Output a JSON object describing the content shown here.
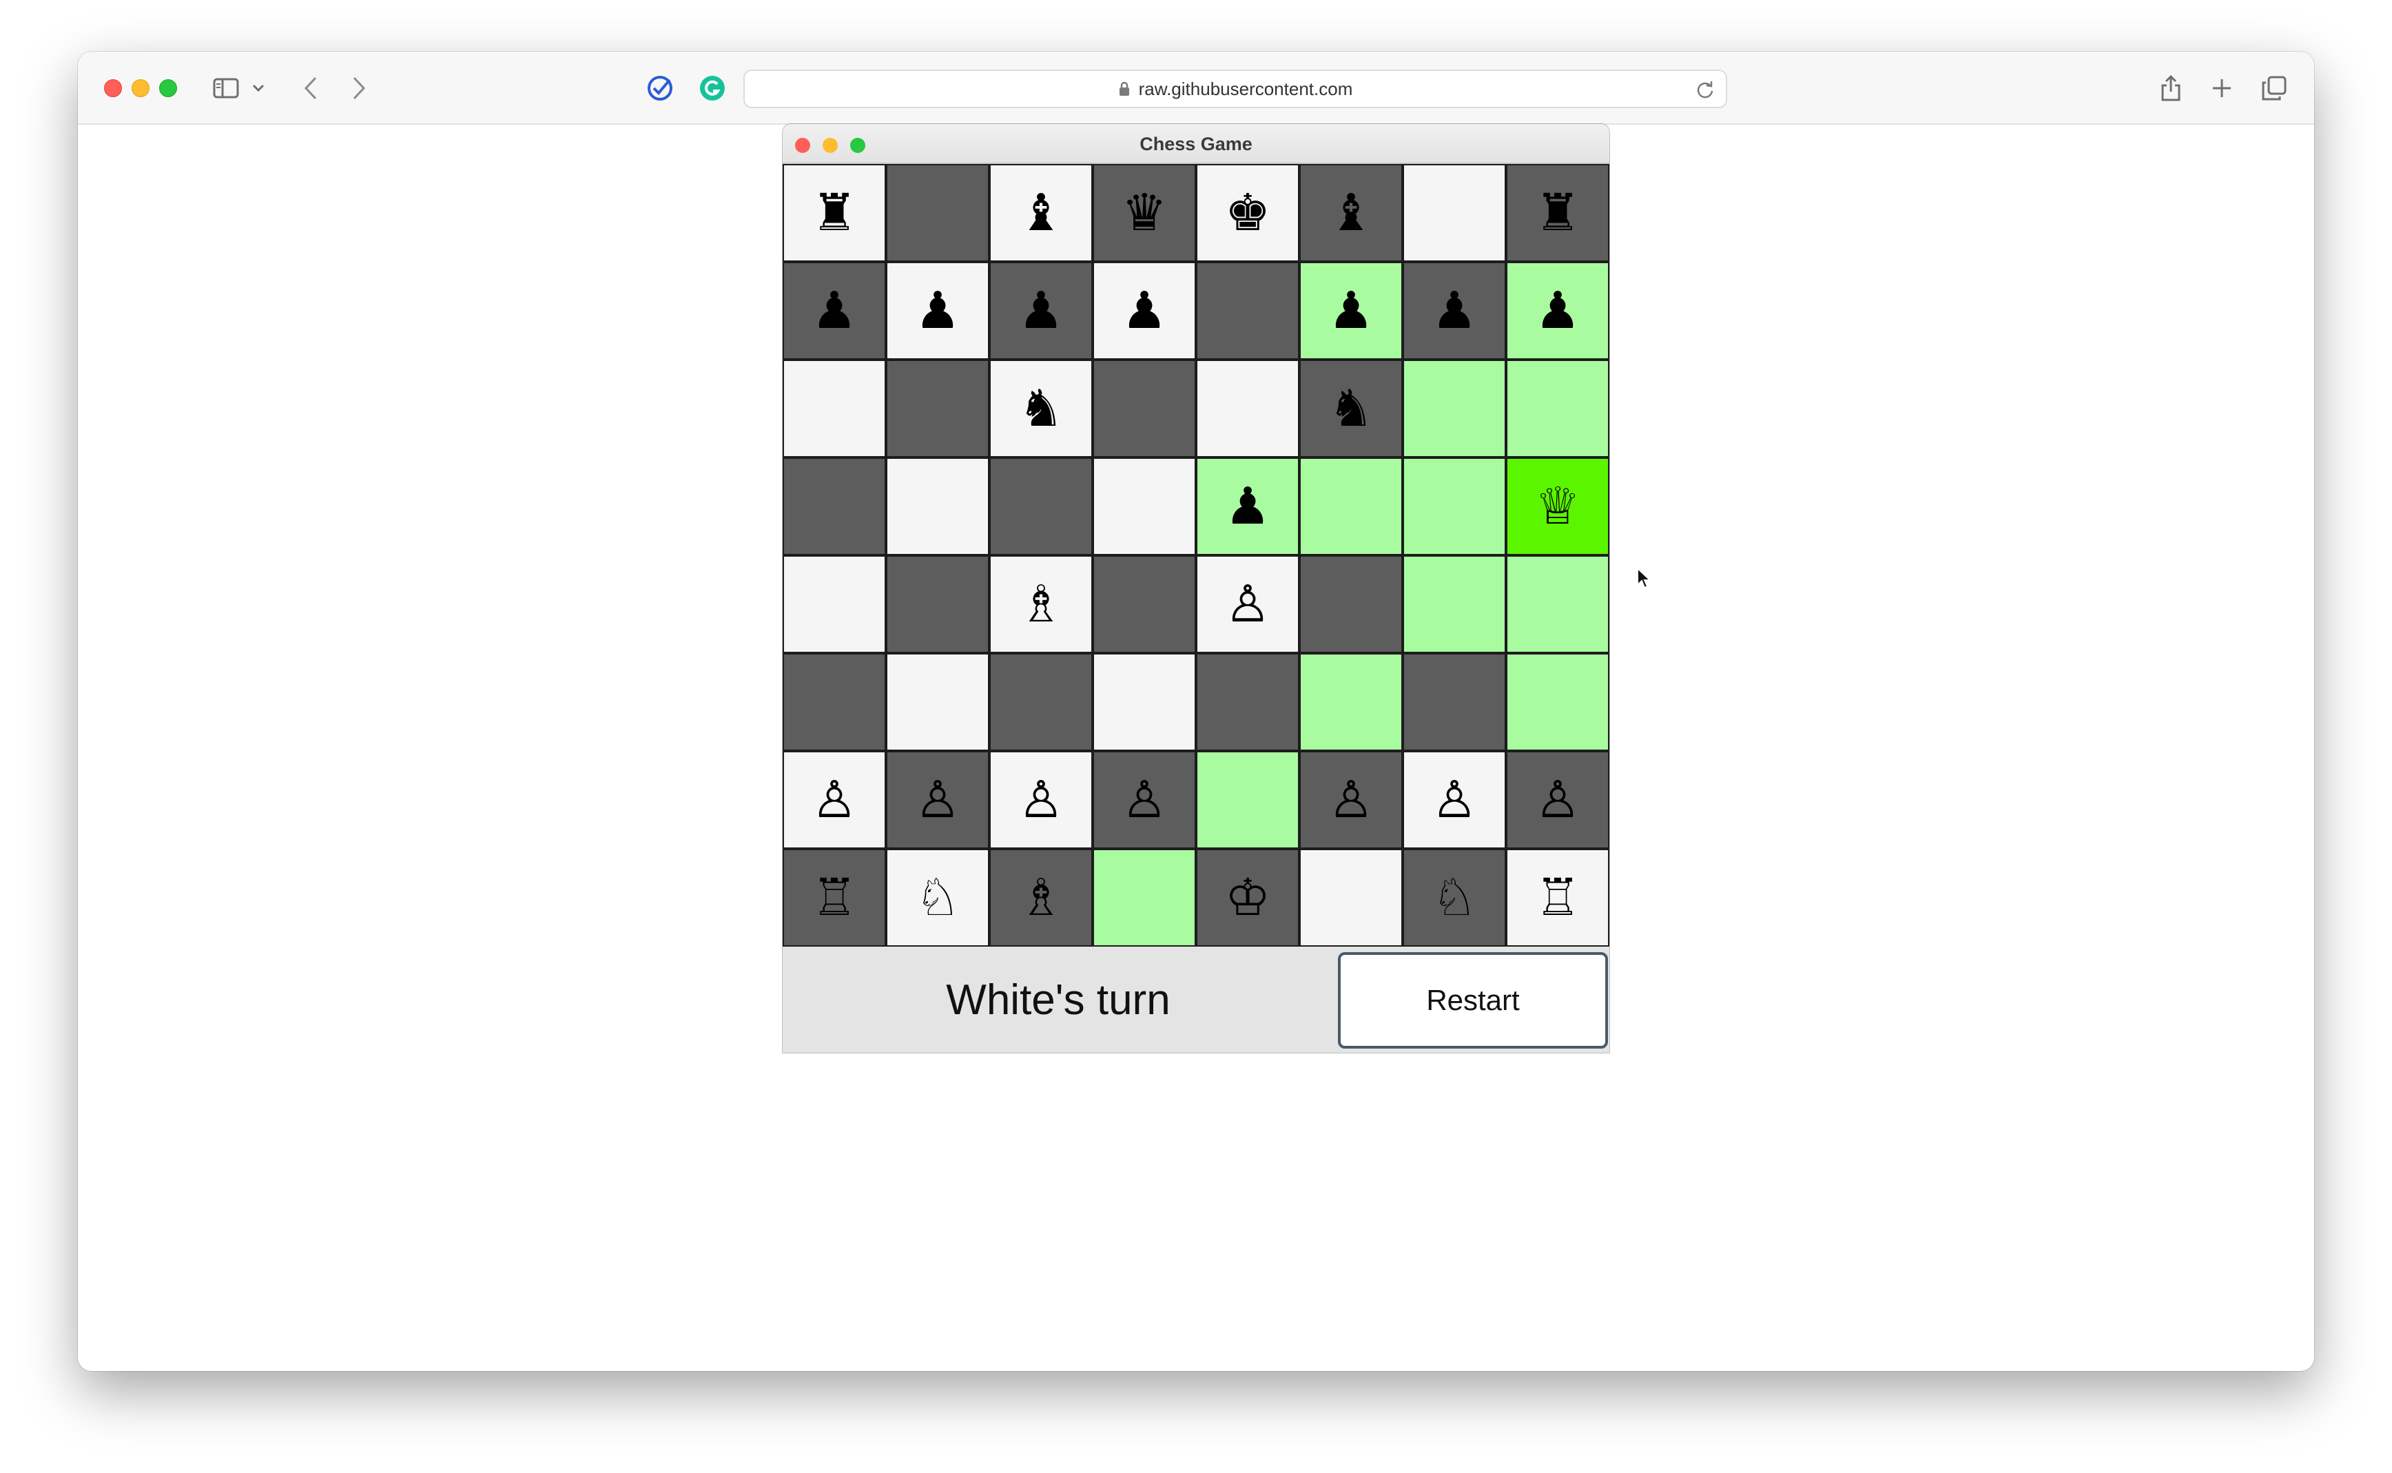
{
  "browser": {
    "url": "raw.githubusercontent.com"
  },
  "app": {
    "title": "Chess Game",
    "turn_label": "White's turn",
    "restart_label": "Restart"
  },
  "colors": {
    "light_square": "#f5f5f5",
    "dark_square": "#5d5d5d",
    "move_highlight": "#a9fba0",
    "selected_square": "#5cf500"
  },
  "board": {
    "rows": [
      [
        {
          "piece": "♜",
          "color": "light"
        },
        {
          "piece": "",
          "color": "dark"
        },
        {
          "piece": "♝",
          "color": "light"
        },
        {
          "piece": "♛",
          "color": "dark"
        },
        {
          "piece": "♚",
          "color": "light"
        },
        {
          "piece": "♝",
          "color": "dark"
        },
        {
          "piece": "",
          "color": "light"
        },
        {
          "piece": "♜",
          "color": "dark"
        }
      ],
      [
        {
          "piece": "♟",
          "color": "dark"
        },
        {
          "piece": "♟",
          "color": "light"
        },
        {
          "piece": "♟",
          "color": "dark"
        },
        {
          "piece": "♟",
          "color": "light"
        },
        {
          "piece": "",
          "color": "dark"
        },
        {
          "piece": "♟",
          "color": "hl"
        },
        {
          "piece": "♟",
          "color": "dark"
        },
        {
          "piece": "♟",
          "color": "hl"
        }
      ],
      [
        {
          "piece": "",
          "color": "light"
        },
        {
          "piece": "",
          "color": "dark"
        },
        {
          "piece": "♞",
          "color": "light"
        },
        {
          "piece": "",
          "color": "dark"
        },
        {
          "piece": "",
          "color": "light"
        },
        {
          "piece": "♞",
          "color": "dark"
        },
        {
          "piece": "",
          "color": "hl"
        },
        {
          "piece": "",
          "color": "hl"
        }
      ],
      [
        {
          "piece": "",
          "color": "dark"
        },
        {
          "piece": "",
          "color": "light"
        },
        {
          "piece": "",
          "color": "dark"
        },
        {
          "piece": "",
          "color": "light"
        },
        {
          "piece": "♟",
          "color": "hl"
        },
        {
          "piece": "",
          "color": "hl"
        },
        {
          "piece": "",
          "color": "hl"
        },
        {
          "piece": "♕",
          "color": "sel"
        }
      ],
      [
        {
          "piece": "",
          "color": "light"
        },
        {
          "piece": "",
          "color": "dark"
        },
        {
          "piece": "♗",
          "color": "light"
        },
        {
          "piece": "",
          "color": "dark"
        },
        {
          "piece": "♙",
          "color": "light"
        },
        {
          "piece": "",
          "color": "dark"
        },
        {
          "piece": "",
          "color": "hl"
        },
        {
          "piece": "",
          "color": "hl"
        }
      ],
      [
        {
          "piece": "",
          "color": "dark"
        },
        {
          "piece": "",
          "color": "light"
        },
        {
          "piece": "",
          "color": "dark"
        },
        {
          "piece": "",
          "color": "light"
        },
        {
          "piece": "",
          "color": "dark"
        },
        {
          "piece": "",
          "color": "hl"
        },
        {
          "piece": "",
          "color": "dark"
        },
        {
          "piece": "",
          "color": "hl"
        }
      ],
      [
        {
          "piece": "♙",
          "color": "light"
        },
        {
          "piece": "♙",
          "color": "dark"
        },
        {
          "piece": "♙",
          "color": "light"
        },
        {
          "piece": "♙",
          "color": "dark"
        },
        {
          "piece": "",
          "color": "hl"
        },
        {
          "piece": "♙",
          "color": "dark"
        },
        {
          "piece": "♙",
          "color": "light"
        },
        {
          "piece": "♙",
          "color": "dark"
        }
      ],
      [
        {
          "piece": "♖",
          "color": "dark"
        },
        {
          "piece": "♘",
          "color": "light"
        },
        {
          "piece": "♗",
          "color": "dark"
        },
        {
          "piece": "",
          "color": "hl"
        },
        {
          "piece": "♔",
          "color": "dark"
        },
        {
          "piece": "",
          "color": "light"
        },
        {
          "piece": "♘",
          "color": "dark"
        },
        {
          "piece": "♖",
          "color": "light"
        }
      ]
    ]
  },
  "icons": {
    "sidebar": "sidebar-icon",
    "back": "chevron-left-icon",
    "forward": "chevron-right-icon",
    "lock": "lock-icon",
    "reload": "reload-icon",
    "share": "share-icon",
    "new_tab": "plus-icon",
    "tab_overview": "tabs-icon"
  }
}
